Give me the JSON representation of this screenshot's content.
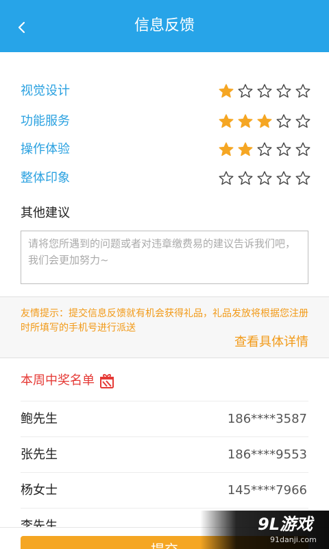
{
  "header": {
    "title": "信息反馈"
  },
  "ratings": [
    {
      "label": "视觉设计",
      "stars": 1,
      "max": 5
    },
    {
      "label": "功能服务",
      "stars": 3,
      "max": 5
    },
    {
      "label": "操作体验",
      "stars": 2,
      "max": 5
    },
    {
      "label": "整体印象",
      "stars": 0,
      "max": 5
    }
  ],
  "colors": {
    "header_bg": "#27a4e8",
    "label_blue": "#2aa1e0",
    "star_filled": "#f5a623",
    "star_empty_stroke": "#444444",
    "tip_orange": "#f29a18",
    "winners_red": "#e53935"
  },
  "suggestion": {
    "title": "其他建议",
    "placeholder": "请将您所遇到的问题或者对违章缴费易的建议告诉我们吧，我们会更加努力~"
  },
  "tip": {
    "text": "友情提示：提交信息反馈就有机会获得礼品，礼品发放将根据您注册时所填写的手机号进行派送",
    "link": "查看具体详情"
  },
  "winners": {
    "title": "本周中奖名单",
    "icon": "gift-icon",
    "rows": [
      {
        "name": "鲍先生",
        "phone": "186****3587"
      },
      {
        "name": "张先生",
        "phone": "186****9553"
      },
      {
        "name": "杨女士",
        "phone": "145****7966"
      },
      {
        "name": "李先生",
        "phone": ""
      }
    ]
  },
  "submit": {
    "label": "提交"
  },
  "watermark": {
    "main": "9L游戏",
    "sub": "91danji.com"
  }
}
